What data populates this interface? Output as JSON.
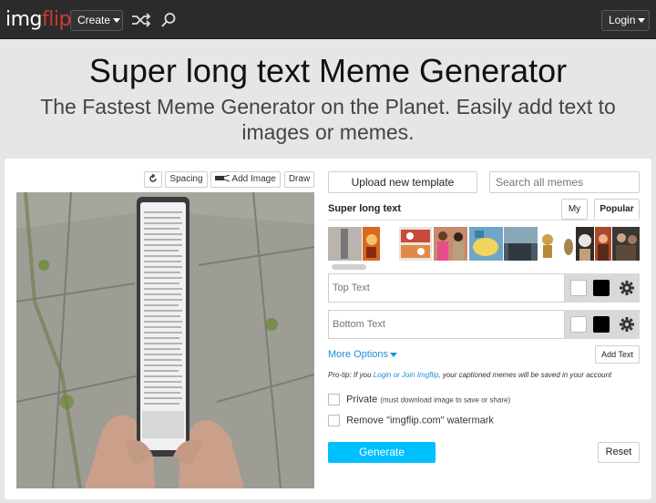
{
  "nav": {
    "logo_a": "img",
    "logo_b": "flip",
    "create_label": "Create",
    "login_label": "Login",
    "icons": [
      "shuffle-icon",
      "search-icon"
    ]
  },
  "hero": {
    "title": "Super long text Meme Generator",
    "subtitle": "The Fastest Meme Generator on the Planet. Easily add text to images or memes."
  },
  "toolbar": {
    "rotate_icon": "rotate-icon",
    "spacing_label": "Spacing",
    "add_image_label": "Add Image",
    "draw_label": "Draw"
  },
  "templates": {
    "upload_label": "Upload new template",
    "search_placeholder": "Search all memes",
    "current_name": "Super long text",
    "tab_my": "My",
    "tab_popular": "Popular"
  },
  "text_boxes": [
    {
      "placeholder": "Top Text",
      "color_fill": "#ffffff",
      "color_outline": "#000000"
    },
    {
      "placeholder": "Bottom Text",
      "color_fill": "#ffffff",
      "color_outline": "#000000"
    }
  ],
  "options": {
    "more_options_label": "More Options",
    "add_text_label": "Add Text",
    "protip_prefix": "Pro-tip: If you ",
    "protip_link": "Login or Join Imgflip",
    "protip_suffix": ", your captioned memes will be saved in your account",
    "private_label": "Private",
    "private_note": "(must download image to save or share)",
    "watermark_label": "Remove \"imgflip.com\" watermark"
  },
  "actions": {
    "generate_label": "Generate",
    "reset_label": "Reset"
  },
  "colors": {
    "accent": "#00bfff",
    "link": "#1a8fd6",
    "logo_red": "#d23a2c",
    "topbar": "#2b2b2b"
  }
}
